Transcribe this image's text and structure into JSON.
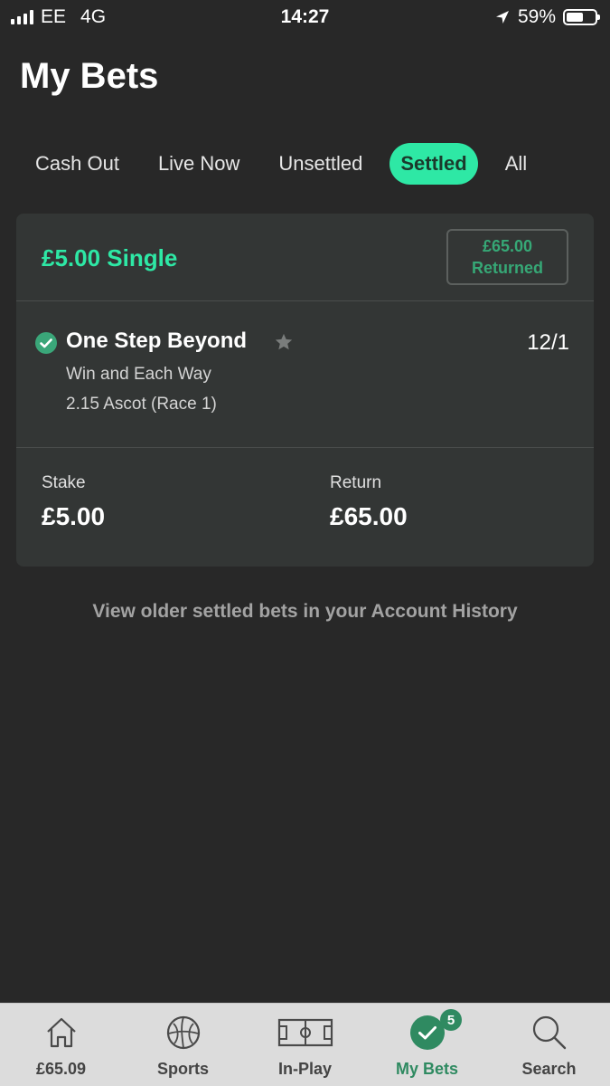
{
  "status_bar": {
    "carrier": "EE",
    "network": "4G",
    "time": "14:27",
    "battery": "59%",
    "battery_level": 0.59
  },
  "page": {
    "title": "My Bets"
  },
  "tabs": [
    {
      "label": "Cash Out",
      "active": false
    },
    {
      "label": "Live Now",
      "active": false
    },
    {
      "label": "Unsettled",
      "active": false
    },
    {
      "label": "Settled",
      "active": true
    },
    {
      "label": "All",
      "active": false
    }
  ],
  "bet": {
    "title": "£5.00 Single",
    "returned_amount": "£65.00",
    "returned_label": "Returned",
    "selection": {
      "name": "One Step Beyond",
      "odds": "12/1",
      "market": "Win and Each Way",
      "event": "2.15 Ascot (Race 1)"
    },
    "stake_label": "Stake",
    "stake_value": "£5.00",
    "return_label": "Return",
    "return_value": "£65.00"
  },
  "history_link": "View older settled bets in your Account History",
  "bottom_nav": [
    {
      "label": "£65.09",
      "icon": "home-icon"
    },
    {
      "label": "Sports",
      "icon": "football-icon"
    },
    {
      "label": "In-Play",
      "icon": "pitch-icon"
    },
    {
      "label": "My Bets",
      "icon": "check-circle-icon",
      "badge": "5",
      "active": true
    },
    {
      "label": "Search",
      "icon": "search-icon"
    }
  ],
  "colors": {
    "accent": "#2ee8a5",
    "dark_green": "#2f8a61",
    "background": "#282828",
    "card": "#333635"
  }
}
